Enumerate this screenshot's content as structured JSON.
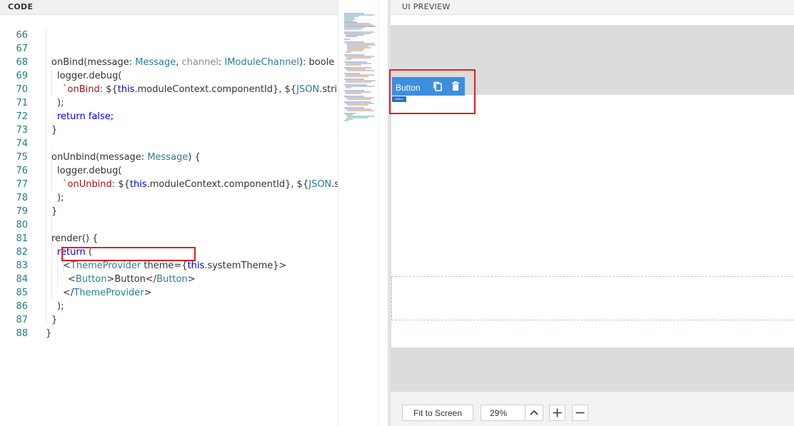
{
  "code_panel": {
    "title": "CODE",
    "lines": [
      {
        "n": "66",
        "t": ""
      },
      {
        "n": "67",
        "t": "onBind"
      },
      {
        "n": "68",
        "t": "logger.debug("
      },
      {
        "n": "69",
        "t": "onBind template"
      },
      {
        "n": "70",
        "t": ");"
      },
      {
        "n": "71",
        "t": "return false;"
      },
      {
        "n": "72",
        "t": "}"
      },
      {
        "n": "73",
        "t": ""
      },
      {
        "n": "74",
        "t": "onUnbind"
      },
      {
        "n": "75",
        "t": "logger.debug("
      },
      {
        "n": "76",
        "t": "onUnbind template"
      },
      {
        "n": "77",
        "t": ");"
      },
      {
        "n": "78",
        "t": "}"
      },
      {
        "n": "79",
        "t": ""
      },
      {
        "n": "80",
        "t": "render() {"
      },
      {
        "n": "81",
        "t": "return ("
      },
      {
        "n": "82",
        "t": "ThemeProvider"
      },
      {
        "n": "83",
        "t": "Button"
      },
      {
        "n": "84",
        "t": "close ThemeProvider"
      },
      {
        "n": "85",
        "t": ");"
      },
      {
        "n": "86",
        "t": "}"
      },
      {
        "n": "87",
        "t": "}"
      },
      {
        "n": "88",
        "t": ""
      }
    ]
  },
  "code_text": {
    "l67_a": "onBind(message: ",
    "l67_b": "Message",
    "l67_c": ", ",
    "l67_d": "channel",
    "l67_e": ": ",
    "l67_f": "IModuleChannel",
    "l67_g": "): boole",
    "l68": "logger.debug(",
    "l69_a": "`onBind: ",
    "l69_b": "${",
    "l69_c": "this",
    "l69_d": ".moduleContext.componentId}, ${",
    "l69_e": "JSON",
    "l69_f": ".strin",
    "l70": ");",
    "l71_a": "return",
    "l71_b": " false;",
    "l72": "}",
    "l74_a": "onUnbind(message: ",
    "l74_b": "Message",
    "l74_c": ") {",
    "l75": "logger.debug(",
    "l76_a": "`onUnbind: ",
    "l76_b": "${",
    "l76_c": "this",
    "l76_d": ".moduleContext.componentId}, ${",
    "l76_e": "JSON",
    "l76_f": ".st",
    "l77": ");",
    "l78": "}",
    "l80": "render() {",
    "l81_a": "return",
    "l81_b": " (",
    "l82_a": "<",
    "l82_b": "ThemeProvider",
    "l82_c": " theme={",
    "l82_d": "this",
    "l82_e": ".systemTheme}>",
    "l83_a": "<",
    "l83_b": "Button",
    "l83_c": ">Button</",
    "l83_d": "Button",
    "l83_e": ">",
    "l84_a": "</",
    "l84_b": "ThemeProvider",
    "l84_c": ">",
    "l85": ");",
    "l86": "}",
    "l87": "}"
  },
  "preview_panel": {
    "title": "UI PREVIEW",
    "selected_component_label": "Button",
    "rendered_button_label": "Button",
    "icons": [
      "copy-icon",
      "trash-icon"
    ]
  },
  "footer": {
    "fit_label": "Fit to Screen",
    "zoom_value": "29%",
    "zoom_in_icon": "plus-icon",
    "zoom_out_icon": "minus-icon"
  },
  "colors": {
    "accent": "#3e8ede",
    "highlight": "#e02020",
    "line_number": "#237893"
  }
}
